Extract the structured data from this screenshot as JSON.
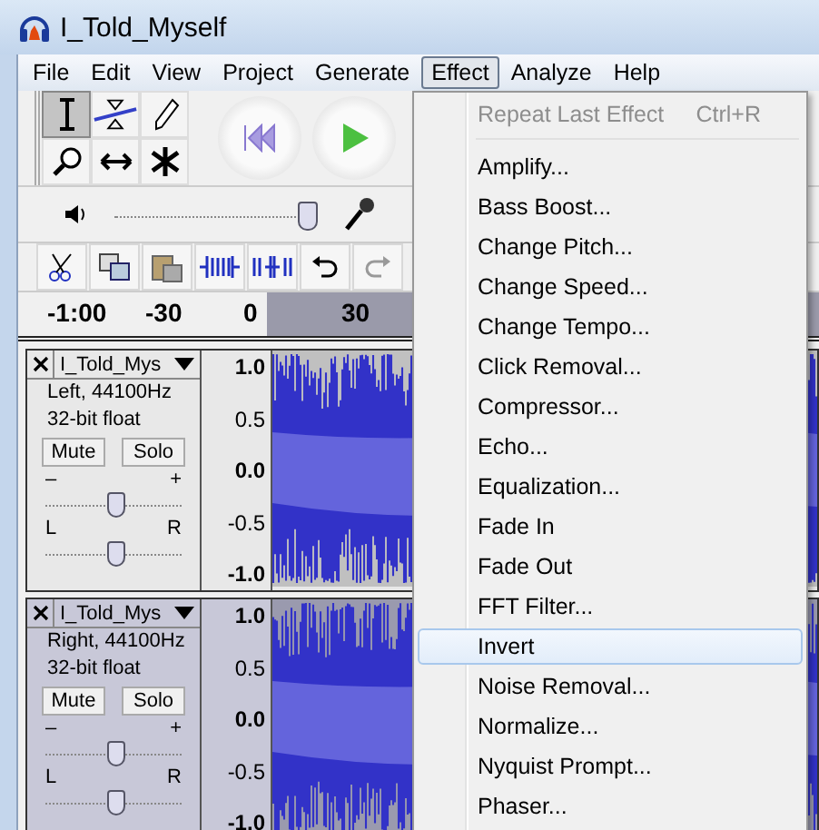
{
  "window": {
    "title": "I_Told_Myself"
  },
  "menu_bar": [
    {
      "label": "File",
      "selected": false
    },
    {
      "label": "Edit",
      "selected": false
    },
    {
      "label": "View",
      "selected": false
    },
    {
      "label": "Project",
      "selected": false
    },
    {
      "label": "Generate",
      "selected": false
    },
    {
      "label": "Effect",
      "selected": true
    },
    {
      "label": "Analyze",
      "selected": false
    },
    {
      "label": "Help",
      "selected": false
    }
  ],
  "volume_slider": {
    "level": 0.95
  },
  "ruler": {
    "ticks": [
      "-1:00",
      "-30",
      "0",
      "30"
    ]
  },
  "tracks": [
    {
      "name": "I_Told_Mys",
      "info": [
        "Left, 44100Hz",
        "32-bit float"
      ],
      "buttons": [
        "Mute",
        "Solo"
      ],
      "gain": {
        "minus": "–",
        "plus": "+",
        "level": 0.5
      },
      "pan": {
        "left": "L",
        "right": "R",
        "level": 0.5
      },
      "scale": [
        "1.0",
        "0.5",
        "0.0",
        "-0.5",
        "-1.0"
      ],
      "selected": false
    },
    {
      "name": "I_Told_Mys",
      "info": [
        "Right, 44100Hz",
        "32-bit float"
      ],
      "buttons": [
        "Mute",
        "Solo"
      ],
      "gain": {
        "minus": "–",
        "plus": "+",
        "level": 0.5
      },
      "pan": {
        "left": "L",
        "right": "R",
        "level": 0.5
      },
      "scale": [
        "1.0",
        "0.5",
        "0.0",
        "-0.5",
        "-1.0"
      ],
      "selected": true
    }
  ],
  "effect_menu": {
    "items": [
      {
        "label": "Repeat Last Effect",
        "shortcut": "Ctrl+R",
        "disabled": true,
        "selected": false,
        "separator_after": true
      },
      {
        "label": "Amplify...",
        "disabled": false,
        "selected": false
      },
      {
        "label": "Bass Boost...",
        "disabled": false,
        "selected": false
      },
      {
        "label": "Change Pitch...",
        "disabled": false,
        "selected": false
      },
      {
        "label": "Change Speed...",
        "disabled": false,
        "selected": false
      },
      {
        "label": "Change Tempo...",
        "disabled": false,
        "selected": false
      },
      {
        "label": "Click Removal...",
        "disabled": false,
        "selected": false
      },
      {
        "label": "Compressor...",
        "disabled": false,
        "selected": false
      },
      {
        "label": "Echo...",
        "disabled": false,
        "selected": false
      },
      {
        "label": "Equalization...",
        "disabled": false,
        "selected": false
      },
      {
        "label": "Fade In",
        "disabled": false,
        "selected": false
      },
      {
        "label": "Fade Out",
        "disabled": false,
        "selected": false
      },
      {
        "label": "FFT Filter...",
        "disabled": false,
        "selected": false
      },
      {
        "label": "Invert",
        "disabled": false,
        "selected": true
      },
      {
        "label": "Noise Removal...",
        "disabled": false,
        "selected": false
      },
      {
        "label": "Normalize...",
        "disabled": false,
        "selected": false
      },
      {
        "label": "Nyquist Prompt...",
        "disabled": false,
        "selected": false
      },
      {
        "label": "Phaser...",
        "disabled": false,
        "selected": false
      }
    ]
  }
}
